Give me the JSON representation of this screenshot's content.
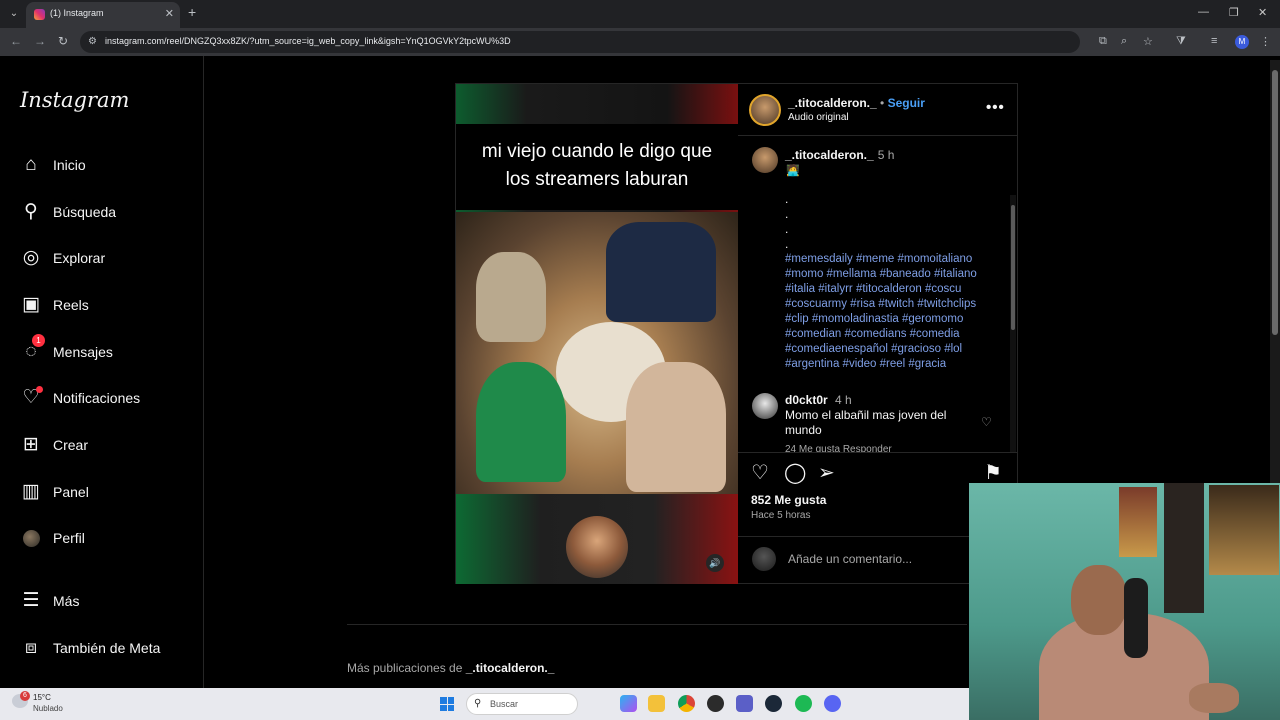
{
  "browser": {
    "tab_title": "(1) Instagram",
    "url": "instagram.com/reel/DNGZQ3xx8ZK/?utm_source=ig_web_copy_link&igsh=YnQ1OGVkY2tpcWU%3D",
    "profile_initial": "M"
  },
  "sidebar": {
    "logo": "Instagram",
    "items": [
      {
        "label": "Inicio",
        "icon": "home-icon"
      },
      {
        "label": "Búsqueda",
        "icon": "search-icon"
      },
      {
        "label": "Explorar",
        "icon": "compass-icon"
      },
      {
        "label": "Reels",
        "icon": "reels-icon"
      },
      {
        "label": "Mensajes",
        "icon": "messenger-icon",
        "badge": "1"
      },
      {
        "label": "Notificaciones",
        "icon": "heart-icon"
      },
      {
        "label": "Crear",
        "icon": "plus-square-icon"
      },
      {
        "label": "Panel",
        "icon": "dashboard-icon"
      },
      {
        "label": "Perfil",
        "icon": "avatar"
      },
      {
        "label": "Más",
        "icon": "menu-icon"
      },
      {
        "label": "También de Meta",
        "icon": "meta-icon"
      }
    ]
  },
  "post": {
    "meme_text_line1": "mi viejo cuando le digo que",
    "meme_text_line2": "los streamers laburan",
    "author": "_.titocalderon._",
    "separator": "•",
    "follow": "Seguir",
    "audio": "Audio original",
    "caption": {
      "user": "_.titocalderon._",
      "time": "5 h",
      "emoji": "🧑‍💻",
      "dots": ".\n.\n.\n.",
      "hashtags": "#memesdaily #meme #momoitaliano #momo #mellama #baneado #italiano #italia #italyrr #titocalderon #coscu #coscuarmy #risa #twitch #twitchclips #clip #momoladinastia #geromomo #comedian #comedians #comedia #comediaenespañol #gracioso #lol #argentina #video #reel #gracia"
    },
    "comment": {
      "user": "d0ckt0r",
      "time": "4 h",
      "text": "Momo el albañil mas joven del mundo",
      "meta": "24 Me gusta   Responder"
    },
    "likes": "852 Me gusta",
    "when": "Hace 5 horas",
    "add_comment_placeholder": "Añade un comentario..."
  },
  "more_posts": {
    "prefix": "Más publicaciones de",
    "user": "_.titocalderon._"
  },
  "taskbar": {
    "weather_temp": "15°C",
    "weather_desc": "Nublado",
    "weather_badge": "6",
    "search_label": "Buscar"
  },
  "colors": {
    "link_blue": "#4a9ff5",
    "hashtag_blue": "#7f9fe6",
    "notification_red": "#ff3040"
  }
}
